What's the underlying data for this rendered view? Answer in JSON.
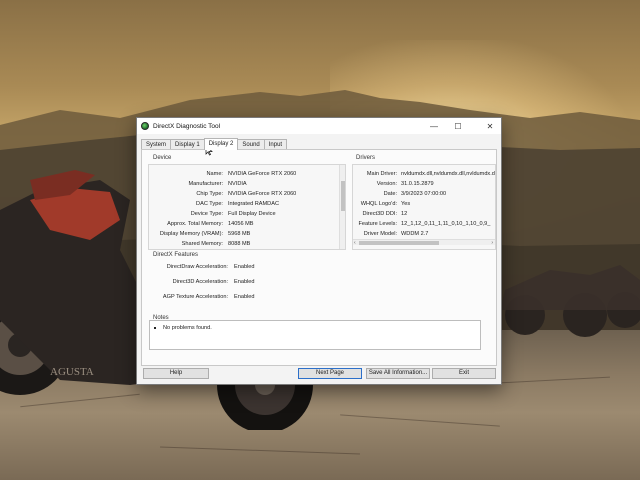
{
  "window": {
    "title": "DirectX Diagnostic Tool",
    "min_glyph": "—",
    "max_glyph": "☐",
    "close_glyph": "✕"
  },
  "tabs": [
    {
      "label": "System",
      "active": false
    },
    {
      "label": "Display 1",
      "active": false
    },
    {
      "label": "Display 2",
      "active": true
    },
    {
      "label": "Sound",
      "active": false
    },
    {
      "label": "Input",
      "active": false
    }
  ],
  "device": {
    "title": "Device",
    "rows": [
      {
        "label": "Name:",
        "value": "NVIDIA GeForce RTX 2060"
      },
      {
        "label": "Manufacturer:",
        "value": "NVIDIA"
      },
      {
        "label": "Chip Type:",
        "value": "NVIDIA GeForce RTX 2060"
      },
      {
        "label": "DAC Type:",
        "value": "Integrated RAMDAC"
      },
      {
        "label": "Device Type:",
        "value": "Full Display Device"
      },
      {
        "label": "Approx. Total Memory:",
        "value": "14056 MB"
      },
      {
        "label": "Display Memory (VRAM):",
        "value": "5968 MB"
      },
      {
        "label": "Shared Memory:",
        "value": "8088 MB"
      }
    ]
  },
  "drivers": {
    "title": "Drivers",
    "rows": [
      {
        "label": "Main Driver:",
        "value": "nvldumdx.dll,nvldumdx.dll,nvldumdx.dll,nvldumdx.c"
      },
      {
        "label": "Version:",
        "value": "31.0.15.2879"
      },
      {
        "label": "Date:",
        "value": "3/9/2023 07:00:00"
      },
      {
        "label": "WHQL Logo'd:",
        "value": "Yes"
      },
      {
        "label": "Direct3D DDI:",
        "value": "12"
      },
      {
        "label": "Feature Levels:",
        "value": "12_1,12_0,11_1,11_0,10_1,10_0,9_"
      },
      {
        "label": "Driver Model:",
        "value": "WDDM 2.7"
      }
    ],
    "left_arrow": "‹",
    "right_arrow": "›"
  },
  "features": {
    "title": "DirectX Features",
    "rows": [
      {
        "label": "DirectDraw Acceleration:",
        "value": "Enabled"
      },
      {
        "label": "Direct3D Acceleration:",
        "value": "Enabled"
      },
      {
        "label": "AGP Texture Acceleration:",
        "value": "Enabled"
      }
    ]
  },
  "notes": {
    "title": "Notes",
    "items": [
      "No problems found."
    ]
  },
  "buttons": {
    "help": "Help",
    "next_page": "Next Page",
    "save_all": "Save All Information...",
    "exit": "Exit"
  },
  "wallpaper": {
    "badge_text": "AGUSTA"
  }
}
